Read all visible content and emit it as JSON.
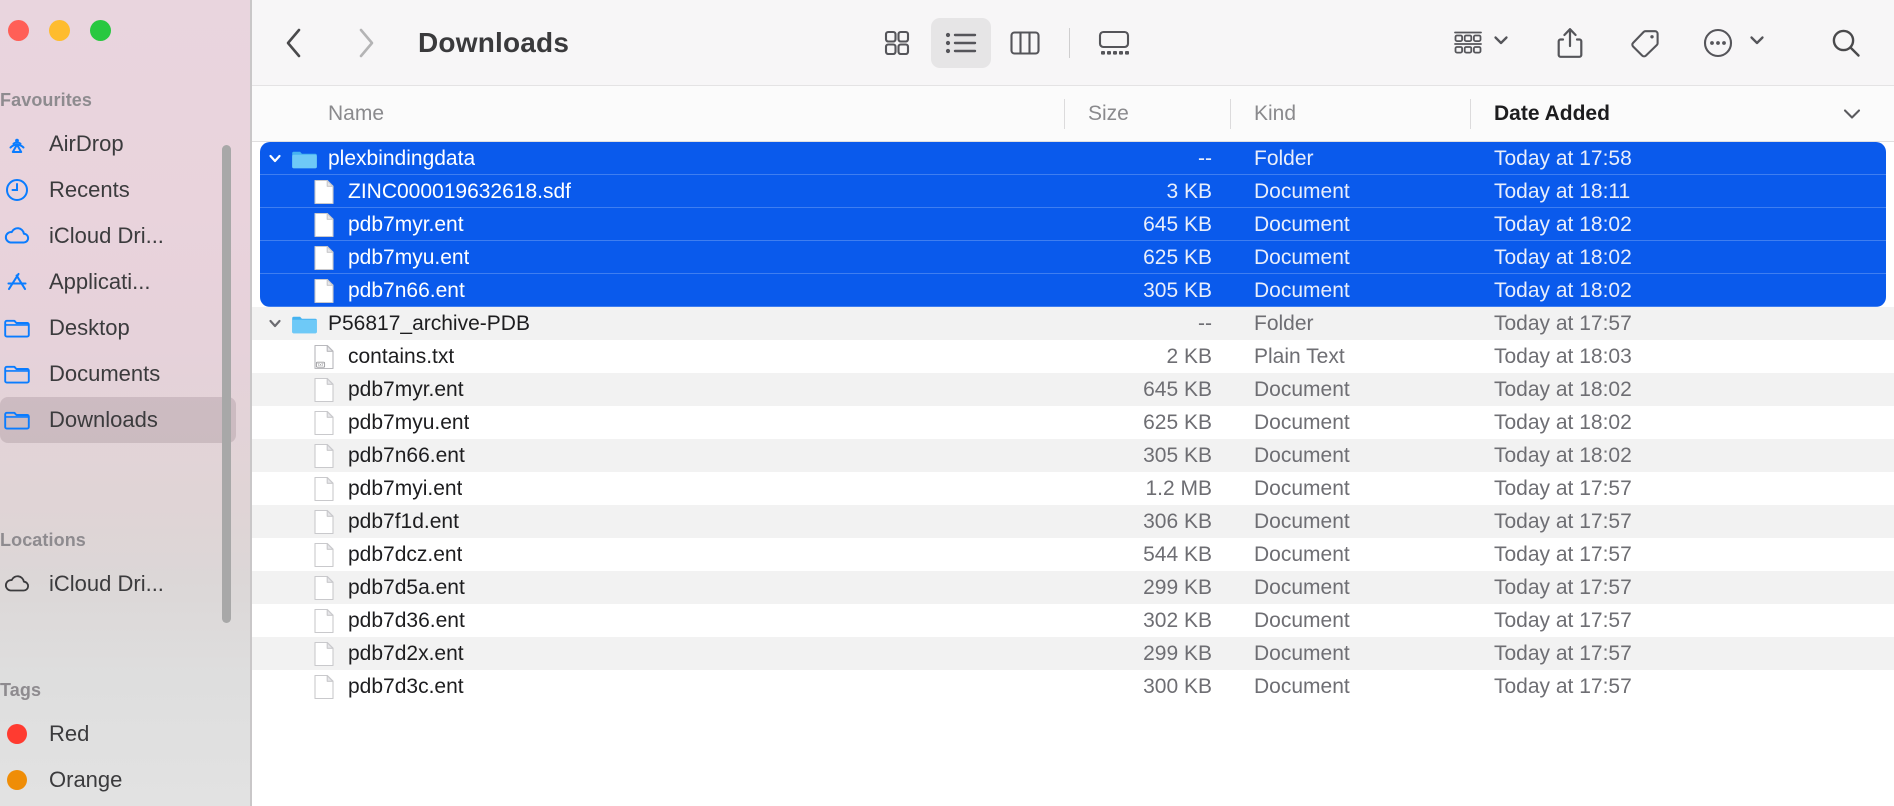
{
  "window": {
    "traffic_lights": [
      {
        "name": "close",
        "color": "#ff5f57"
      },
      {
        "name": "minimize",
        "color": "#febc2e"
      },
      {
        "name": "maximize",
        "color": "#28c840"
      }
    ]
  },
  "sidebar": {
    "sections": [
      {
        "title": "Favourites",
        "items": [
          {
            "label": "AirDrop",
            "icon": "airdrop-icon",
            "selected": false
          },
          {
            "label": "Recents",
            "icon": "clock-icon",
            "selected": false
          },
          {
            "label": "iCloud Dri...",
            "icon": "cloud-icon",
            "selected": false
          },
          {
            "label": "Applicati...",
            "icon": "applications-icon",
            "selected": false
          },
          {
            "label": "Desktop",
            "icon": "folder-icon",
            "selected": false
          },
          {
            "label": "Documents",
            "icon": "folder-icon",
            "selected": false
          },
          {
            "label": "Downloads",
            "icon": "folder-icon",
            "selected": true
          }
        ]
      },
      {
        "title": "Locations",
        "items": [
          {
            "label": "iCloud Dri...",
            "icon": "cloud-outline-icon",
            "selected": false
          }
        ]
      },
      {
        "title": "Tags",
        "items": [
          {
            "label": "Red",
            "icon": "tag-dot-icon",
            "color": "#ff3b30",
            "selected": false
          },
          {
            "label": "Orange",
            "icon": "tag-dot-icon",
            "color": "#ef8d07",
            "selected": false
          }
        ]
      }
    ]
  },
  "toolbar": {
    "back_label": "Back",
    "forward_label": "Forward",
    "forward_disabled": true,
    "title": "Downloads",
    "view_modes": [
      {
        "name": "icon-view",
        "label": "as Icons",
        "active": false
      },
      {
        "name": "list-view",
        "label": "as List",
        "active": true
      },
      {
        "name": "column-view",
        "label": "as Columns",
        "active": false
      },
      {
        "name": "gallery-view",
        "label": "as Gallery",
        "active": false
      }
    ],
    "actions": [
      {
        "name": "group-by-button",
        "label": "Group",
        "has_chevron": true
      },
      {
        "name": "share-button",
        "label": "Share",
        "has_chevron": false
      },
      {
        "name": "tag-button",
        "label": "Tags",
        "has_chevron": false
      },
      {
        "name": "more-button",
        "label": "More",
        "has_chevron": true
      },
      {
        "name": "search-button",
        "label": "Search",
        "has_chevron": false
      }
    ]
  },
  "columns": {
    "name": "Name",
    "size": "Size",
    "kind": "Kind",
    "date_added": "Date Added",
    "sort_by": "Date Added",
    "sort_direction": "descending"
  },
  "colors": {
    "selection_blue": "#0a5aec",
    "stripe_gray": "#f2f2f2",
    "sidebar_selected": "rgba(140,120,128,0.26)",
    "folder_blue": "#54bdf5"
  },
  "rows": [
    {
      "name": "plexbindingdata",
      "size": "--",
      "kind": "Folder",
      "date": "Today at 17:58",
      "type": "folder",
      "level": 0,
      "expanded": true,
      "selected": true,
      "stripe": false
    },
    {
      "name": "ZINC000019632618.sdf",
      "size": "3 KB",
      "kind": "Document",
      "date": "Today at 18:11",
      "type": "doc",
      "level": 1,
      "expanded": false,
      "selected": true,
      "stripe": true
    },
    {
      "name": "pdb7myr.ent",
      "size": "645 KB",
      "kind": "Document",
      "date": "Today at 18:02",
      "type": "doc",
      "level": 1,
      "expanded": false,
      "selected": true,
      "stripe": false
    },
    {
      "name": "pdb7myu.ent",
      "size": "625 KB",
      "kind": "Document",
      "date": "Today at 18:02",
      "type": "doc",
      "level": 1,
      "expanded": false,
      "selected": true,
      "stripe": true
    },
    {
      "name": "pdb7n66.ent",
      "size": "305 KB",
      "kind": "Document",
      "date": "Today at 18:02",
      "type": "doc",
      "level": 1,
      "expanded": false,
      "selected": true,
      "stripe": false
    },
    {
      "name": "P56817_archive-PDB",
      "size": "--",
      "kind": "Folder",
      "date": "Today at 17:57",
      "type": "folder",
      "level": 0,
      "expanded": true,
      "selected": false,
      "stripe": true
    },
    {
      "name": "contains.txt",
      "size": "2 KB",
      "kind": "Plain Text",
      "date": "Today at 18:03",
      "type": "txt",
      "level": 1,
      "expanded": false,
      "selected": false,
      "stripe": false
    },
    {
      "name": "pdb7myr.ent",
      "size": "645 KB",
      "kind": "Document",
      "date": "Today at 18:02",
      "type": "doc",
      "level": 1,
      "expanded": false,
      "selected": false,
      "stripe": true
    },
    {
      "name": "pdb7myu.ent",
      "size": "625 KB",
      "kind": "Document",
      "date": "Today at 18:02",
      "type": "doc",
      "level": 1,
      "expanded": false,
      "selected": false,
      "stripe": false
    },
    {
      "name": "pdb7n66.ent",
      "size": "305 KB",
      "kind": "Document",
      "date": "Today at 18:02",
      "type": "doc",
      "level": 1,
      "expanded": false,
      "selected": false,
      "stripe": true
    },
    {
      "name": "pdb7myi.ent",
      "size": "1.2 MB",
      "kind": "Document",
      "date": "Today at 17:57",
      "type": "doc",
      "level": 1,
      "expanded": false,
      "selected": false,
      "stripe": false
    },
    {
      "name": "pdb7f1d.ent",
      "size": "306 KB",
      "kind": "Document",
      "date": "Today at 17:57",
      "type": "doc",
      "level": 1,
      "expanded": false,
      "selected": false,
      "stripe": true
    },
    {
      "name": "pdb7dcz.ent",
      "size": "544 KB",
      "kind": "Document",
      "date": "Today at 17:57",
      "type": "doc",
      "level": 1,
      "expanded": false,
      "selected": false,
      "stripe": false
    },
    {
      "name": "pdb7d5a.ent",
      "size": "299 KB",
      "kind": "Document",
      "date": "Today at 17:57",
      "type": "doc",
      "level": 1,
      "expanded": false,
      "selected": false,
      "stripe": true
    },
    {
      "name": "pdb7d36.ent",
      "size": "302 KB",
      "kind": "Document",
      "date": "Today at 17:57",
      "type": "doc",
      "level": 1,
      "expanded": false,
      "selected": false,
      "stripe": false
    },
    {
      "name": "pdb7d2x.ent",
      "size": "299 KB",
      "kind": "Document",
      "date": "Today at 17:57",
      "type": "doc",
      "level": 1,
      "expanded": false,
      "selected": false,
      "stripe": true
    },
    {
      "name": "pdb7d3c.ent",
      "size": "300 KB",
      "kind": "Document",
      "date": "Today at 17:57",
      "type": "doc",
      "level": 1,
      "expanded": false,
      "selected": false,
      "stripe": false
    }
  ]
}
